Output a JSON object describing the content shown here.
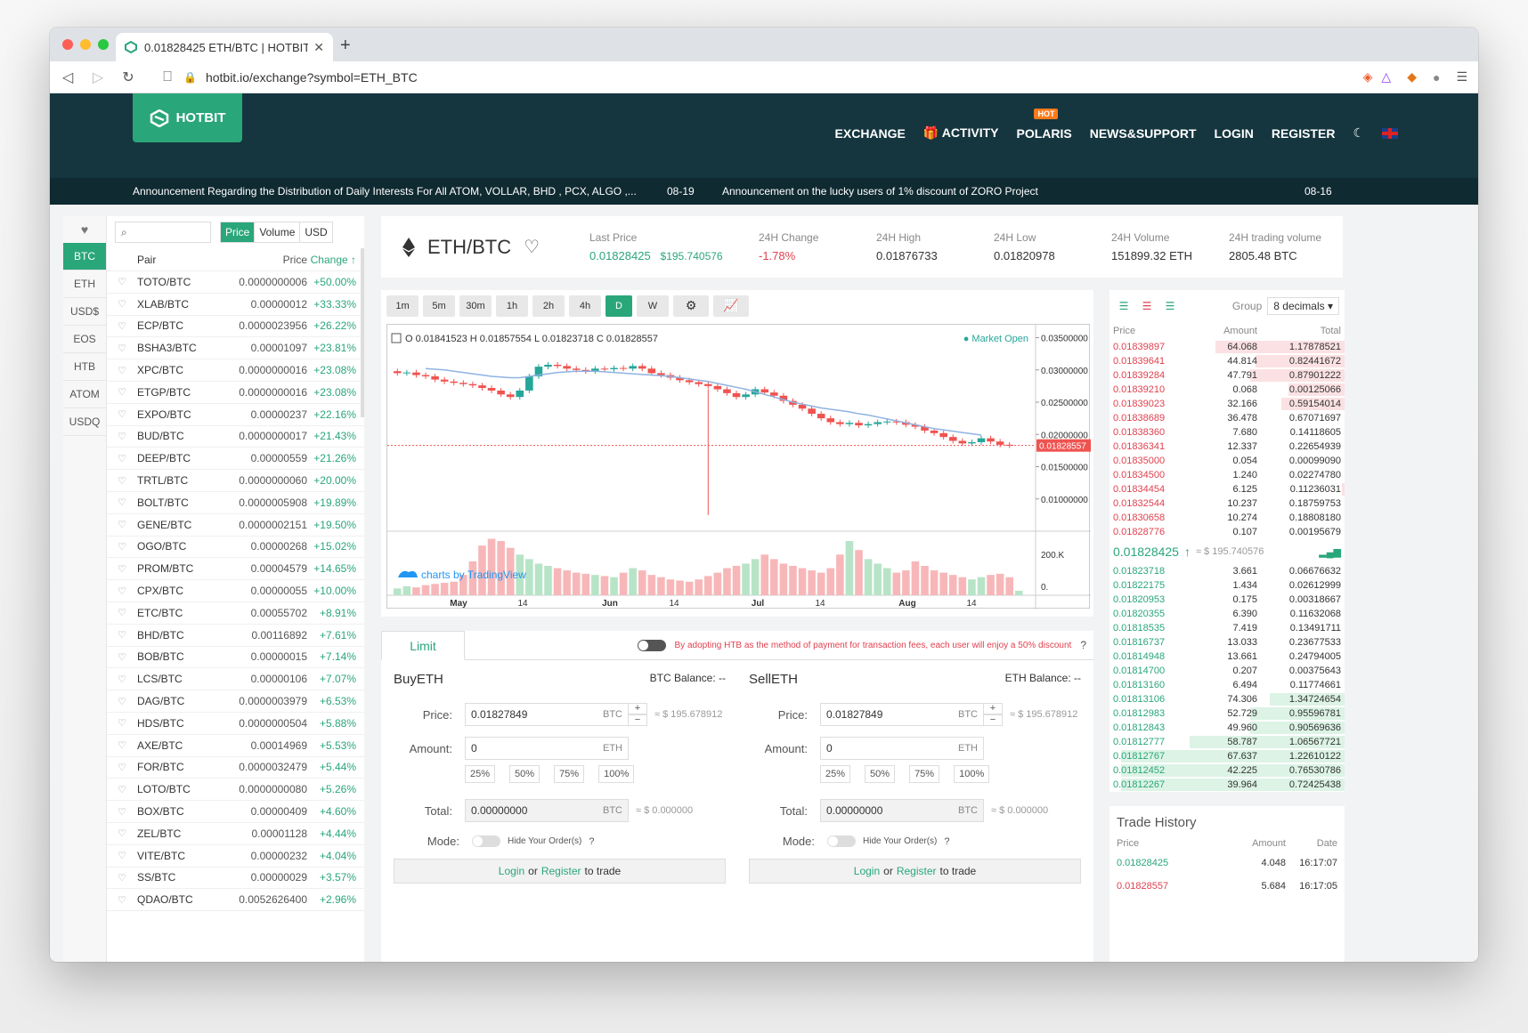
{
  "browser": {
    "tab_title": "0.01828425 ETH/BTC | HOTBIT",
    "url": "hotbit.io/exchange?symbol=ETH_BTC"
  },
  "site": {
    "brand": "HOTBIT",
    "nav": [
      "EXCHANGE",
      "ACTIVITY",
      "POLARIS",
      "NEWS&SUPPORT",
      "LOGIN",
      "REGISTER"
    ],
    "hot_badge": "HOT",
    "news": [
      {
        "text": "Announcement Regarding the Distribution of Daily Interests For All ATOM, VOLLAR, BHD , PCX, ALGO ,...",
        "date": "08-19"
      },
      {
        "text": "Announcement on the lucky users of 1% discount of ZORO Project",
        "date": "08-16"
      }
    ]
  },
  "market": {
    "categories": [
      "BTC",
      "ETH",
      "USD$",
      "EOS",
      "HTB",
      "ATOM",
      "USDQ"
    ],
    "active_category": "BTC",
    "filters": [
      "Price",
      "Volume",
      "USD"
    ],
    "headers": {
      "pair": "Pair",
      "price": "Price",
      "change": "Change ↑"
    },
    "rows": [
      {
        "pair": "TOTO/BTC",
        "price": "0.0000000006",
        "change": "+50.00%"
      },
      {
        "pair": "XLAB/BTC",
        "price": "0.00000012",
        "change": "+33.33%"
      },
      {
        "pair": "ECP/BTC",
        "price": "0.0000023956",
        "change": "+26.22%"
      },
      {
        "pair": "BSHA3/BTC",
        "price": "0.00001097",
        "change": "+23.81%"
      },
      {
        "pair": "XPC/BTC",
        "price": "0.0000000016",
        "change": "+23.08%"
      },
      {
        "pair": "ETGP/BTC",
        "price": "0.0000000016",
        "change": "+23.08%"
      },
      {
        "pair": "EXPO/BTC",
        "price": "0.00000237",
        "change": "+22.16%"
      },
      {
        "pair": "BUD/BTC",
        "price": "0.0000000017",
        "change": "+21.43%"
      },
      {
        "pair": "DEEP/BTC",
        "price": "0.00000559",
        "change": "+21.26%"
      },
      {
        "pair": "TRTL/BTC",
        "price": "0.0000000060",
        "change": "+20.00%"
      },
      {
        "pair": "BOLT/BTC",
        "price": "0.0000005908",
        "change": "+19.89%"
      },
      {
        "pair": "GENE/BTC",
        "price": "0.0000002151",
        "change": "+19.50%"
      },
      {
        "pair": "OGO/BTC",
        "price": "0.00000268",
        "change": "+15.02%"
      },
      {
        "pair": "PROM/BTC",
        "price": "0.00004579",
        "change": "+14.65%"
      },
      {
        "pair": "CPX/BTC",
        "price": "0.00000055",
        "change": "+10.00%"
      },
      {
        "pair": "ETC/BTC",
        "price": "0.00055702",
        "change": "+8.91%"
      },
      {
        "pair": "BHD/BTC",
        "price": "0.00116892",
        "change": "+7.61%"
      },
      {
        "pair": "BOB/BTC",
        "price": "0.00000015",
        "change": "+7.14%"
      },
      {
        "pair": "LCS/BTC",
        "price": "0.00000106",
        "change": "+7.07%"
      },
      {
        "pair": "DAG/BTC",
        "price": "0.0000003979",
        "change": "+6.53%"
      },
      {
        "pair": "HDS/BTC",
        "price": "0.0000000504",
        "change": "+5.88%"
      },
      {
        "pair": "AXE/BTC",
        "price": "0.00014969",
        "change": "+5.53%"
      },
      {
        "pair": "FOR/BTC",
        "price": "0.0000032479",
        "change": "+5.44%"
      },
      {
        "pair": "LOTO/BTC",
        "price": "0.0000000080",
        "change": "+5.26%"
      },
      {
        "pair": "BOX/BTC",
        "price": "0.00000409",
        "change": "+4.60%"
      },
      {
        "pair": "ZEL/BTC",
        "price": "0.00001128",
        "change": "+4.44%"
      },
      {
        "pair": "VITE/BTC",
        "price": "0.00000232",
        "change": "+4.04%"
      },
      {
        "pair": "SS/BTC",
        "price": "0.00000029",
        "change": "+3.57%"
      },
      {
        "pair": "QDAO/BTC",
        "price": "0.0052626400",
        "change": "+2.96%"
      }
    ]
  },
  "ticker": {
    "pair": "ETH/BTC",
    "last_price_label": "Last Price",
    "last_price": "0.01828425",
    "last_price_usd": "$195.740576",
    "change_label": "24H Change",
    "change": "-1.78%",
    "high_label": "24H High",
    "high": "0.01876733",
    "low_label": "24H Low",
    "low": "0.01820978",
    "volume_label": "24H Volume",
    "volume": "151899.32 ETH",
    "trading_label": "24H trading volume",
    "trading": "2805.48 BTC"
  },
  "chart": {
    "intervals": [
      "1m",
      "5m",
      "30m",
      "1h",
      "2h",
      "4h",
      "D",
      "W"
    ],
    "active_interval": "D",
    "ohlc": {
      "o": "0.01841523",
      "h": "0.01857554",
      "l": "0.01823718",
      "c": "0.01828557"
    },
    "market_status": "Market Open",
    "watermark": "charts by TradingView",
    "y_ticks": [
      "0.03500000",
      "0.03000000",
      "0.02500000",
      "0.02000000",
      "0.01500000",
      "0.01000000"
    ],
    "last_tag": "0.01828557",
    "vol_ticks": [
      "200.K",
      "0."
    ],
    "x_ticks": [
      "May",
      "14",
      "Jun",
      "14",
      "Jul",
      "14",
      "Aug",
      "14"
    ]
  },
  "chart_data": {
    "type": "bar",
    "title": "",
    "xlabel": "",
    "ylabel": "",
    "ylim": [
      0.005,
      0.037
    ],
    "x_ticks": [
      "May",
      "14",
      "Jun",
      "14",
      "Jul",
      "14",
      "Aug",
      "14"
    ],
    "series": [
      {
        "values": [
          0.0295,
          0.0296,
          0.0292,
          0.029,
          0.0285,
          0.0282,
          0.028,
          0.0278,
          0.0276,
          0.0272,
          0.0268,
          0.0262,
          0.0258,
          0.0268,
          0.029,
          0.0305,
          0.0308,
          0.0306,
          0.0302,
          0.03,
          0.0298,
          0.0302,
          0.0301,
          0.0303,
          0.0302,
          0.0306,
          0.0302,
          0.0295,
          0.0292,
          0.0288,
          0.0284,
          0.0281,
          0.0278,
          0.0275,
          0.027,
          0.0264,
          0.0258,
          0.0262,
          0.027,
          0.0265,
          0.026,
          0.0252,
          0.0246,
          0.024,
          0.0232,
          0.0225,
          0.0219,
          0.0216,
          0.0218,
          0.0214,
          0.0216,
          0.0219,
          0.022,
          0.0219,
          0.0215,
          0.0212,
          0.0206,
          0.0202,
          0.0196,
          0.019,
          0.0186,
          0.0188,
          0.0194,
          0.0189,
          0.0184,
          0.0183
        ]
      },
      {
        "values": [
          0.0302,
          0.0301,
          0.03,
          0.0298,
          0.0296,
          0.0294,
          0.0292,
          0.029,
          0.0289,
          0.0288,
          0.0288,
          0.029,
          0.0292,
          0.0294,
          0.0296,
          0.0297,
          0.0298,
          0.0298,
          0.0298,
          0.0297,
          0.0296,
          0.0295,
          0.0294,
          0.0293,
          0.0292,
          0.0291,
          0.029,
          0.0288,
          0.0286,
          0.0284,
          0.0282,
          0.0279,
          0.0276,
          0.0273,
          0.027,
          0.0266,
          0.0262,
          0.0258,
          0.0254,
          0.025,
          0.0247,
          0.0244,
          0.0241,
          0.0239,
          0.0237,
          0.0235,
          0.0232,
          0.023,
          0.0227,
          0.0224,
          0.0221,
          0.0218,
          0.0215,
          0.0212,
          0.0209,
          0.0207,
          0.0205,
          0.0203,
          0.0201,
          0.0199
        ]
      },
      {
        "values": [
          30,
          40,
          35,
          45,
          50,
          55,
          60,
          90,
          150,
          220,
          250,
          240,
          210,
          180,
          160,
          140,
          130,
          120,
          110,
          100,
          95,
          90,
          85,
          80,
          100,
          120,
          110,
          90,
          80,
          70,
          65,
          60,
          70,
          85,
          100,
          120,
          130,
          140,
          160,
          180,
          160,
          140,
          130,
          120,
          110,
          100,
          120,
          180,
          240,
          200,
          160,
          140,
          120,
          100,
          110,
          150,
          130,
          110,
          100,
          90,
          80,
          70,
          80,
          90,
          95,
          80,
          20
        ]
      }
    ]
  },
  "order": {
    "tab": "Limit",
    "notice": "By adopting HTB as the method of payment for transaction fees, each user will enjoy a 50% discount",
    "buy": {
      "title": "BuyETH",
      "balance": "BTC Balance: --",
      "price_label": "Price:",
      "price": "0.01827849",
      "price_unit": "BTC",
      "price_usd": "≈ $ 195.678912",
      "amount_label": "Amount:",
      "amount": "0",
      "amount_unit": "ETH",
      "total_label": "Total:",
      "total": "0.00000000",
      "total_unit": "BTC",
      "total_usd": "≈ $ 0.000000",
      "mode_label": "Mode:",
      "hide_label": "Hide Your Order(s)"
    },
    "sell": {
      "title": "SellETH",
      "balance": "ETH Balance: --",
      "price_label": "Price:",
      "price": "0.01827849",
      "price_unit": "BTC",
      "price_usd": "≈ $ 195.678912",
      "amount_label": "Amount:",
      "amount": "0",
      "amount_unit": "ETH",
      "total_label": "Total:",
      "total": "0.00000000",
      "total_unit": "BTC",
      "total_usd": "≈ $ 0.000000",
      "mode_label": "Mode:",
      "hide_label": "Hide Your Order(s)"
    },
    "percents": [
      "25%",
      "50%",
      "75%",
      "100%"
    ],
    "login": "Login",
    "or": "or",
    "register": "Register",
    "to_trade": "to trade"
  },
  "book": {
    "group_label": "Group",
    "group_value": "8 decimals",
    "cols": [
      "Price",
      "Amount",
      "Total"
    ],
    "asks": [
      {
        "price": "0.01839897",
        "amount": "64.068",
        "total": "1.17878521",
        "depth": 0.55
      },
      {
        "price": "0.01839641",
        "amount": "44.814",
        "total": "0.82441672",
        "depth": 0.38
      },
      {
        "price": "0.01839284",
        "amount": "47.791",
        "total": "0.87901222",
        "depth": 0.4
      },
      {
        "price": "0.01839210",
        "amount": "0.068",
        "total": "0.00125066",
        "depth": 0.24
      },
      {
        "price": "0.01839023",
        "amount": "32.166",
        "total": "0.59154014",
        "depth": 0.27
      },
      {
        "price": "0.01838689",
        "amount": "36.478",
        "total": "0.67071697",
        "depth": 0
      },
      {
        "price": "0.01838360",
        "amount": "7.680",
        "total": "0.14118605",
        "depth": 0
      },
      {
        "price": "0.01836341",
        "amount": "12.337",
        "total": "0.22654939",
        "depth": 0
      },
      {
        "price": "0.01835000",
        "amount": "0.054",
        "total": "0.00099090",
        "depth": 0
      },
      {
        "price": "0.01834500",
        "amount": "1.240",
        "total": "0.02274780",
        "depth": 0
      },
      {
        "price": "0.01834454",
        "amount": "6.125",
        "total": "0.11236031",
        "depth": 0.01
      },
      {
        "price": "0.01832544",
        "amount": "10.237",
        "total": "0.18759753",
        "depth": 0
      },
      {
        "price": "0.01830658",
        "amount": "10.274",
        "total": "0.18808180",
        "depth": 0
      },
      {
        "price": "0.01828776",
        "amount": "0.107",
        "total": "0.00195679",
        "depth": 0
      }
    ],
    "last_price": "0.01828425",
    "last_usd": "≈ $ 195.740576",
    "bids": [
      {
        "price": "0.01823718",
        "amount": "3.661",
        "total": "0.06676632",
        "depth": 0
      },
      {
        "price": "0.01822175",
        "amount": "1.434",
        "total": "0.02612999",
        "depth": 0
      },
      {
        "price": "0.01820953",
        "amount": "0.175",
        "total": "0.00318667",
        "depth": 0
      },
      {
        "price": "0.01820355",
        "amount": "6.390",
        "total": "0.11632068",
        "depth": 0
      },
      {
        "price": "0.01818535",
        "amount": "7.419",
        "total": "0.13491711",
        "depth": 0
      },
      {
        "price": "0.01816737",
        "amount": "13.033",
        "total": "0.23677533",
        "depth": 0
      },
      {
        "price": "0.01814948",
        "amount": "13.661",
        "total": "0.24794005",
        "depth": 0
      },
      {
        "price": "0.01814700",
        "amount": "0.207",
        "total": "0.00375643",
        "depth": 0
      },
      {
        "price": "0.01813160",
        "amount": "6.494",
        "total": "0.11774661",
        "depth": 0
      },
      {
        "price": "0.01813106",
        "amount": "74.306",
        "total": "1.34724654",
        "depth": 0.32
      },
      {
        "price": "0.01812983",
        "amount": "52.729",
        "total": "0.95596781",
        "depth": 0.4
      },
      {
        "price": "0.01812843",
        "amount": "49.960",
        "total": "0.90569636",
        "depth": 0.4
      },
      {
        "price": "0.01812777",
        "amount": "58.787",
        "total": "1.06567721",
        "depth": 0.66
      },
      {
        "price": "0.01812767",
        "amount": "67.637",
        "total": "1.22610122",
        "depth": 0.95
      },
      {
        "price": "0.01812452",
        "amount": "42.225",
        "total": "0.76530786",
        "depth": 0.95
      },
      {
        "price": "0.01812267",
        "amount": "39.964",
        "total": "0.72425438",
        "depth": 0.95
      }
    ]
  },
  "history": {
    "title": "Trade History",
    "cols": [
      "Price",
      "Amount",
      "Date"
    ],
    "rows": [
      {
        "price": "0.01828425",
        "amount": "4.048",
        "date": "16:17:07",
        "side": "buy"
      },
      {
        "price": "0.01828557",
        "amount": "5.684",
        "date": "16:17:05",
        "side": "sell"
      }
    ]
  },
  "colors": {
    "accent": "#2aa67b",
    "down": "#e0414f",
    "header": "#15363f"
  }
}
